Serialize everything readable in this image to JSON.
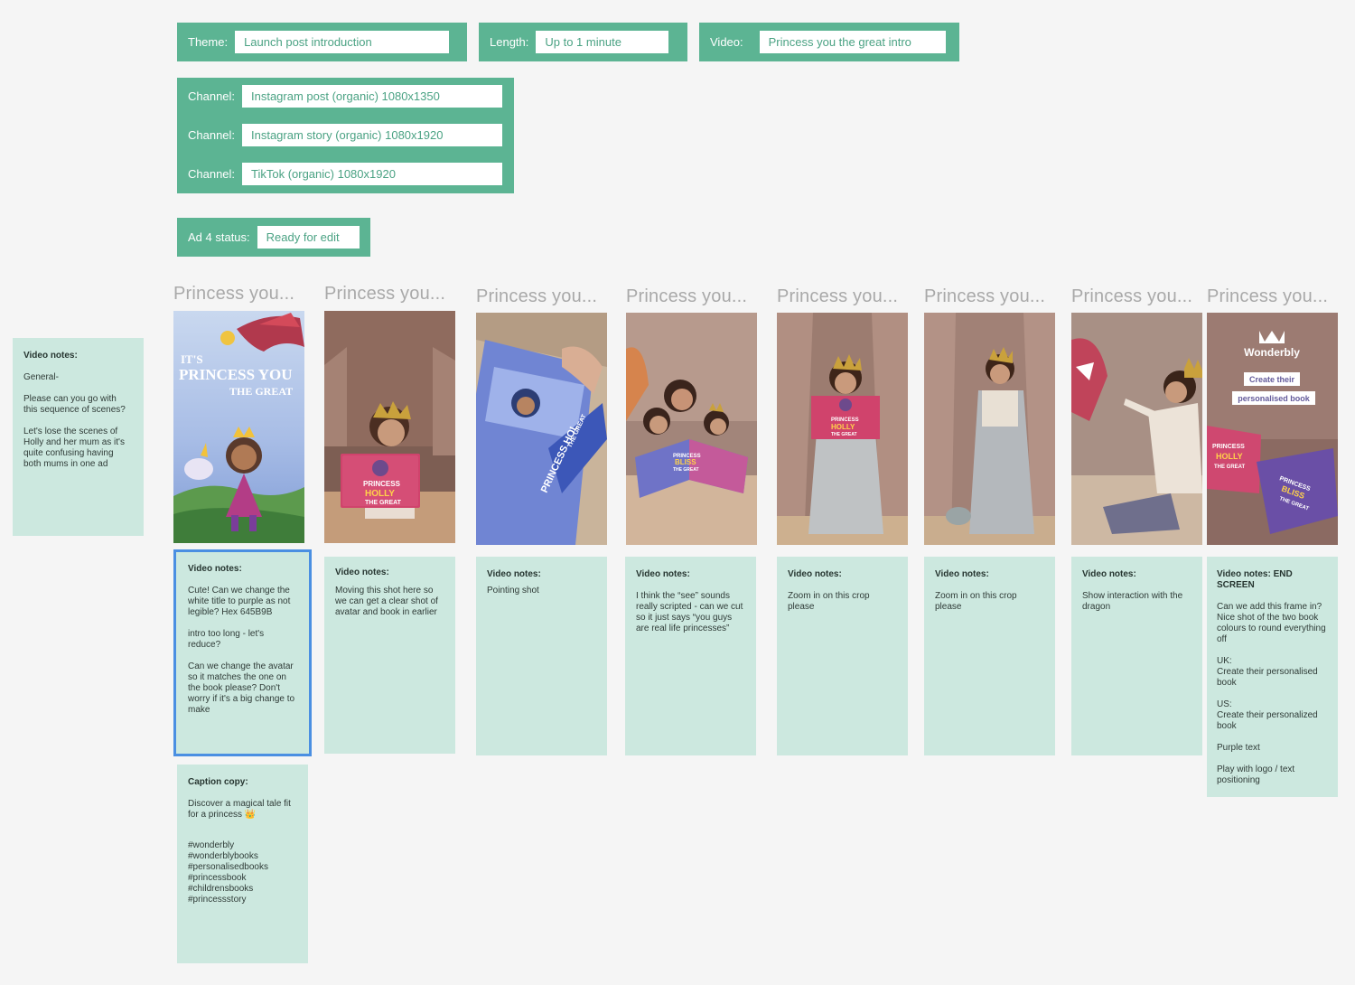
{
  "brief": {
    "theme": {
      "label": "Theme:",
      "value": "Launch post introduction"
    },
    "length": {
      "label": "Length:",
      "value": "Up to 1 minute"
    },
    "video": {
      "label": "Video:",
      "value": "Princess you the great intro"
    },
    "channels": [
      {
        "label": "Channel:",
        "value": "Instagram post (organic) 1080x1350"
      },
      {
        "label": "Channel:",
        "value": "Instagram story (organic) 1080x1920"
      },
      {
        "label": "Channel:",
        "value": "TikTok (organic) 1080x1920"
      }
    ],
    "status": {
      "label": "Ad 4 status:",
      "value": "Ready for edit"
    }
  },
  "general_note": {
    "title": "Video notes:",
    "paragraphs": [
      "General-",
      "Please can you go with this sequence of scenes?",
      "Let's lose the scenes of Holly and her mum as it's quite confusing having both mums in one ad"
    ]
  },
  "frames": [
    {
      "title": "Princess you...",
      "thumb_text": [
        "IT'S",
        "PRINCESS YOU",
        "THE GREAT"
      ]
    },
    {
      "title": "Princess you...",
      "thumb_text": [
        "PRINCESS",
        "HOLLY",
        "THE GREAT"
      ]
    },
    {
      "title": "Princess you...",
      "thumb_text": [
        "PRINCESS HOL",
        "THE GREAT"
      ]
    },
    {
      "title": "Princess you...",
      "thumb_text": [
        "PRINCESS",
        "BLISS",
        "THE GREAT"
      ]
    },
    {
      "title": "Princess you...",
      "thumb_text": [
        "PRINCESS",
        "HOLLY",
        "THE GREAT"
      ]
    },
    {
      "title": "Princess you...",
      "thumb_text": []
    },
    {
      "title": "Princess you...",
      "thumb_text": []
    },
    {
      "title": "Princess you...",
      "thumb_text": [
        "Wonderbly",
        "Create their",
        "personalised book",
        "PRINCESS",
        "HOLLY",
        "THE GREAT",
        "PRINCESS",
        "BLISS",
        "THE GREAT"
      ]
    }
  ],
  "notes": [
    {
      "title": "Video notes:",
      "paragraphs": [
        "Cute! Can we change the white title to purple as not legible? Hex 645B9B",
        "intro too long - let's reduce?",
        "Can we change the avatar so it matches the one on the book please? Don't worry if it's a big change to make"
      ]
    },
    {
      "title": "Video notes:",
      "paragraphs": [
        "Moving this shot here so we can get a clear shot of avatar and book in earlier"
      ]
    },
    {
      "title": "Video notes:",
      "paragraphs": [
        "Pointing shot"
      ]
    },
    {
      "title": "Video notes:",
      "paragraphs": [
        "I think the “see” sounds really scripted - can we cut so it just says “you guys are real life princesses”"
      ]
    },
    {
      "title": "Video notes:",
      "paragraphs": [
        "Zoom in on this crop please"
      ]
    },
    {
      "title": "Video notes:",
      "paragraphs": [
        "Zoom in on this crop please"
      ]
    },
    {
      "title": "Video notes:",
      "paragraphs": [
        "Show interaction with the dragon"
      ]
    },
    {
      "title": "Video notes: END SCREEN",
      "paragraphs": [
        "Can we add this frame in? Nice shot of the two book colours to round everything off",
        "UK:\nCreate their personalised book",
        "US:\nCreate their personalized book",
        "Purple text",
        "Play with logo / text positioning"
      ]
    }
  ],
  "caption": {
    "title": "Caption copy:",
    "paragraphs": [
      "Discover a magical tale fit for a princess 👑",
      "#wonderbly\n#wonderblybooks\n#personalisedbooks\n#princessbook\n#childrensbooks\n#princessstory"
    ]
  },
  "colors": {
    "accent_green": "#5cb493",
    "note_bg": "#cce8df",
    "selection_blue": "#4a8fe2",
    "purple": "#645b9b"
  }
}
